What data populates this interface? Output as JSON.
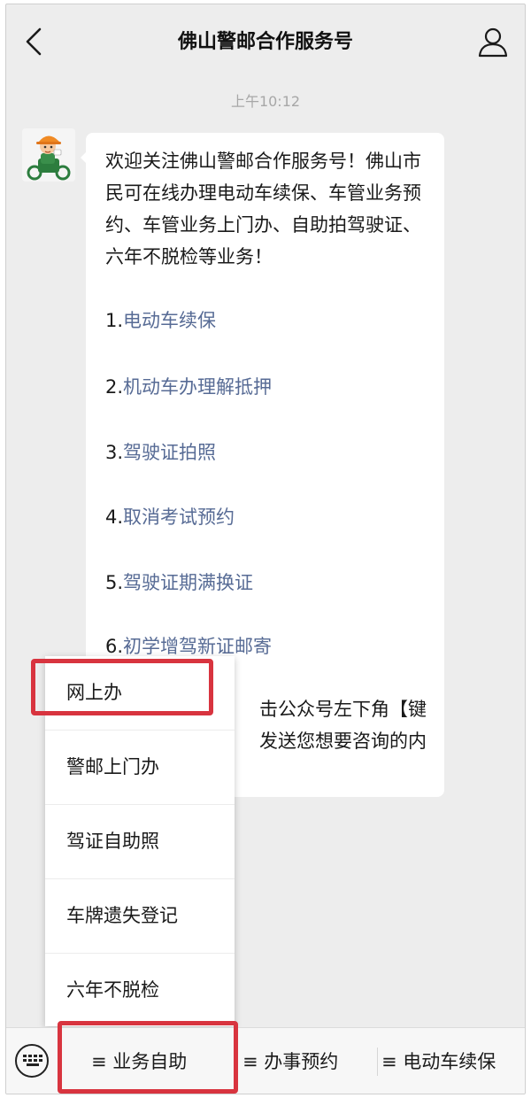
{
  "header": {
    "title": "佛山警邮合作服务号",
    "back_icon": "back-arrow-icon",
    "profile_icon": "person-icon"
  },
  "chat": {
    "timestamp": "上午10:12",
    "message": {
      "intro": "欢迎关注佛山警邮合作服务号！佛山市民可在线办理电动车续保、车管业务预约、车管业务上门办、自助拍驾驶证、六年不脱检等业务！",
      "links": [
        {
          "num": "1.",
          "text": "电动车续保"
        },
        {
          "num": "2.",
          "text": "机动车办理解抵押"
        },
        {
          "num": "3.",
          "text": "驾驶证拍照"
        },
        {
          "num": "4.",
          "text": "取消考试预约"
        },
        {
          "num": "5.",
          "text": "驾驶证期满换证"
        },
        {
          "num": "6.",
          "text": "初学增驾新证邮寄"
        }
      ],
      "tail_line1": "击公众号左下角【键",
      "tail_line2": "发送您想要咨询的内"
    }
  },
  "popup_menu": {
    "items": [
      "网上办",
      "警邮上门办",
      "驾证自助照",
      "车牌遗失登记",
      "六年不脱检"
    ],
    "highlighted_index": 0
  },
  "bottom_menu": {
    "keyboard_icon": "keyboard-icon",
    "tabs": [
      "≡ 业务自助",
      "≡ 办事预约",
      "≡ 电动车续保"
    ],
    "highlighted_index": 0
  },
  "colors": {
    "link": "#576b95",
    "highlight": "#d8343f",
    "chat_background": "#ededed"
  }
}
